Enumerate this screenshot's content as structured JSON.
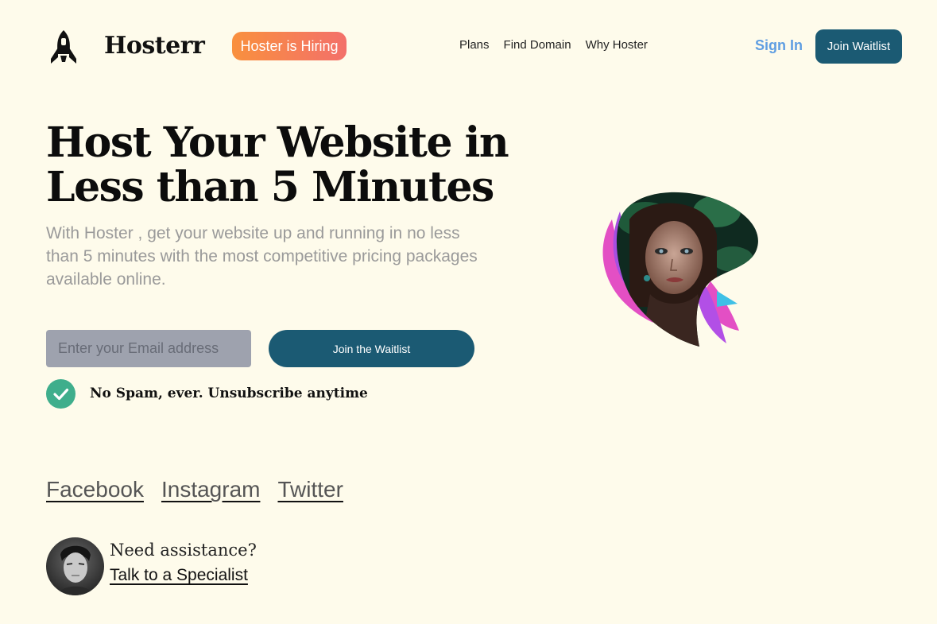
{
  "header": {
    "brand": "Hosterr",
    "hiring_badge": "Hoster is Hiring",
    "nav": [
      "Plans",
      "Find Domain",
      "Why Hoster"
    ],
    "sign_in": "Sign In",
    "join_waitlist": "Join Waitlist"
  },
  "hero": {
    "headline": "Host Your Website in Less than 5 Minutes",
    "subtext": "With Hoster , get your website up and running in no less than 5 minutes with the most competitive pricing packages available online.",
    "email_placeholder": "Enter your Email address",
    "cta": "Join the Waitlist",
    "no_spam": "No Spam, ever. Unsubscribe anytime"
  },
  "social": [
    "Facebook",
    "Instagram",
    "Twitter"
  ],
  "assistance": {
    "question": "Need assistance?",
    "link": "Talk to a Specialist"
  },
  "colors": {
    "background": "#fefbeb",
    "primary": "#1b5a73",
    "sign_in": "#5f9ee2",
    "check": "#3fae8c",
    "hiring_gradient_start": "#f9903e",
    "hiring_gradient_end": "#f3706a"
  },
  "icons": [
    "rocket-icon",
    "check-circle-icon"
  ]
}
